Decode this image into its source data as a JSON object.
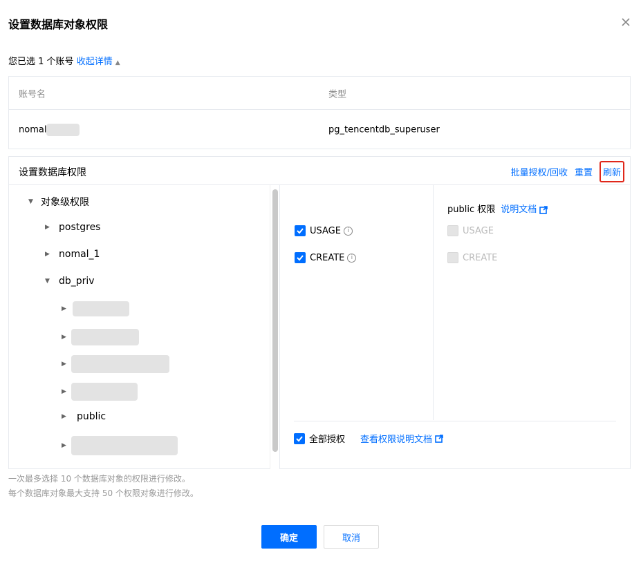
{
  "dialog": {
    "title": "设置数据库对象权限"
  },
  "summary": {
    "text": "您已选 1 个账号",
    "toggle": "收起详情"
  },
  "accounts": {
    "headers": [
      "账号名",
      "类型"
    ],
    "rows": [
      {
        "name": "nomal",
        "type": "pg_tencentdb_superuser"
      }
    ]
  },
  "perm": {
    "title": "设置数据库权限",
    "batch": "批量授权/回收",
    "reset": "重置",
    "refresh": "刷新"
  },
  "tree": {
    "root": "对象级权限",
    "dbs": [
      "postgres",
      "nomal_1",
      "db_priv"
    ],
    "schema_public": "public"
  },
  "privileges": {
    "usage": "USAGE",
    "create": "CREATE"
  },
  "public_panel": {
    "label": "public 权限",
    "doc": "说明文档",
    "usage": "USAGE",
    "create": "CREATE"
  },
  "footer": {
    "all": "全部授权",
    "doc": "查看权限说明文档"
  },
  "notes": [
    "一次最多选择 10 个数据库对象的权限进行修改。",
    "每个数据库对象最大支持 50 个权限对象进行修改。"
  ],
  "buttons": {
    "ok": "确定",
    "cancel": "取消"
  },
  "colors": {
    "accent": "#006eff",
    "highlight": "#e0271a"
  }
}
